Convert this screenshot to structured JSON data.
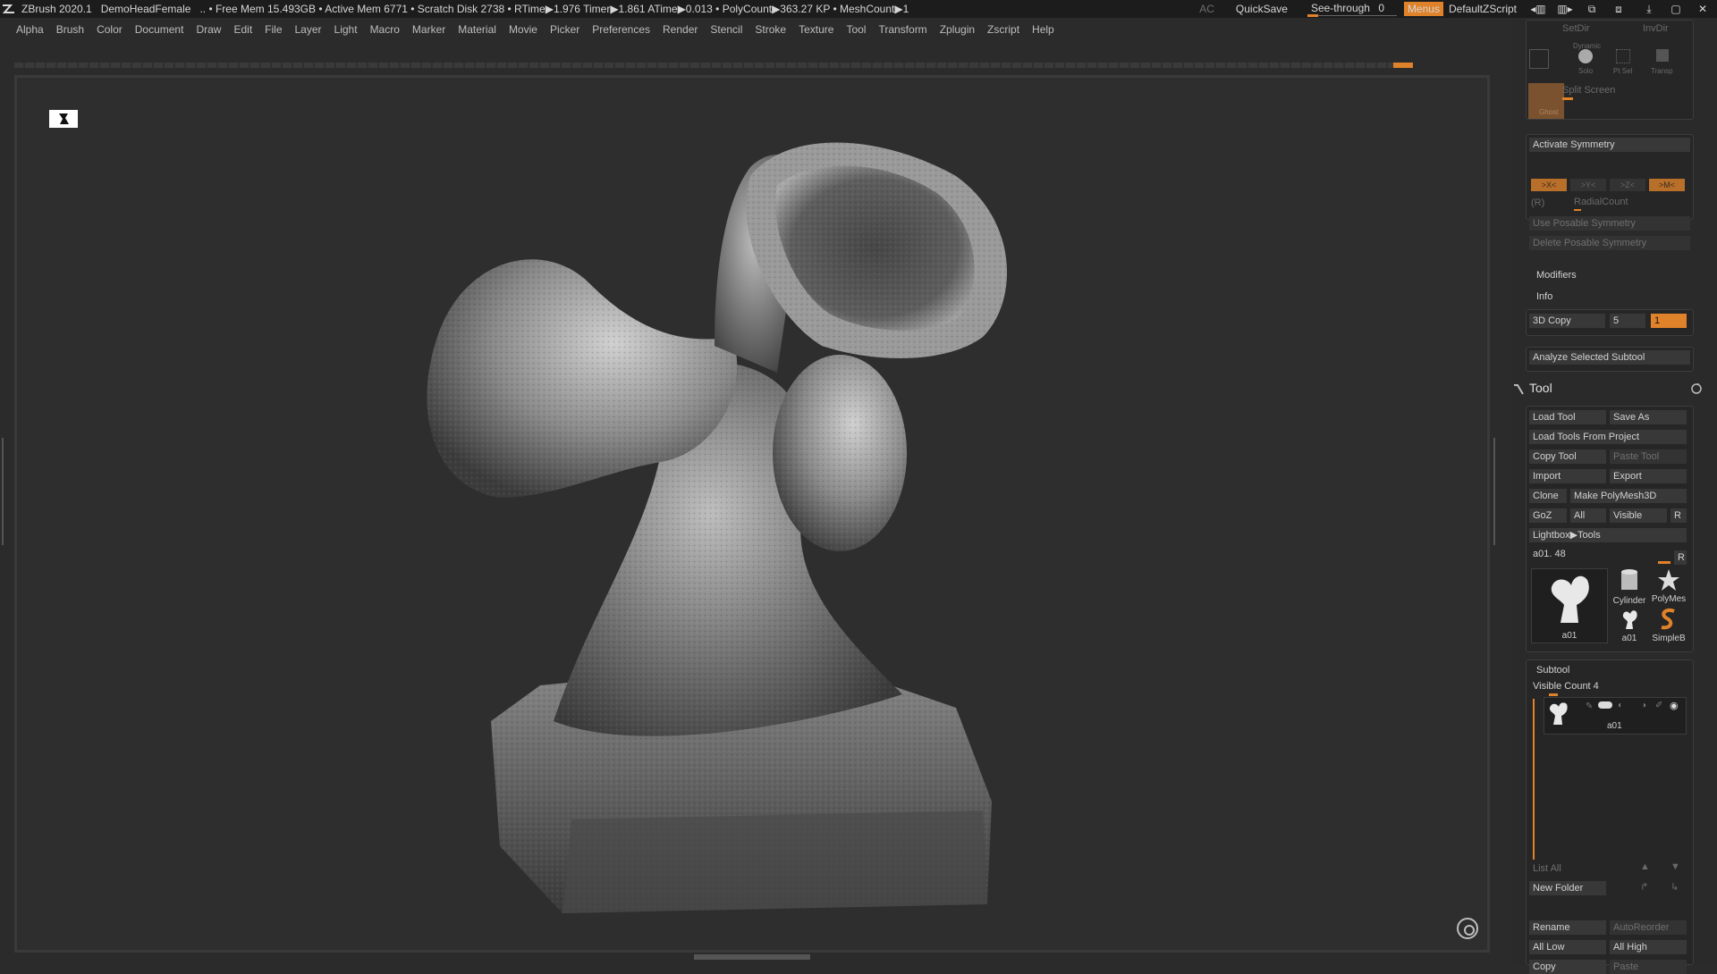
{
  "topbar": {
    "app": "ZBrush 2020.1",
    "project": "DemoHeadFemale",
    "info": "..  • Free Mem 15.493GB • Active Mem 6771 • Scratch Disk 2738 •  RTime▶1.976 Timer▶1.861 ATime▶0.013 • PolyCount▶363.27 KP  • MeshCount▶1",
    "ac": "AC",
    "quicksave": "QuickSave",
    "seethrough_label": "See-through",
    "seethrough_value": "0",
    "menus": "Menus",
    "script": "DefaultZScript"
  },
  "menubar": [
    "Alpha",
    "Brush",
    "Color",
    "Document",
    "Draw",
    "Edit",
    "File",
    "Layer",
    "Light",
    "Macro",
    "Marker",
    "Material",
    "Movie",
    "Picker",
    "Preferences",
    "Render",
    "Stencil",
    "Stroke",
    "Texture",
    "Tool",
    "Transform",
    "Zplugin",
    "Zscript",
    "Help"
  ],
  "panel": {
    "setdir": "SetDir",
    "invdir": "InvDir",
    "dynamic": "Dynamic",
    "solo": "Solo",
    "ptsel": "Pt Sel",
    "transp": "Transp",
    "ghost": "Ghost",
    "split_screen": "Split Screen",
    "activate_symmetry": "Activate Symmetry",
    "sym_x": ">X<",
    "sym_y": ">Y<",
    "sym_z": ">Z<",
    "sym_m": ">M<",
    "r_label": "(R)",
    "radial_count": "RadialCount",
    "use_posable": "Use Posable Symmetry",
    "delete_posable": "Delete Posable Symmetry",
    "modifiers": "Modifiers",
    "info": "Info",
    "copy3d": "3D Copy",
    "copy3d_val": "5",
    "copy3d_input": "1",
    "analyze": "Analyze Selected Subtool",
    "tool_title": "Tool",
    "load_tool": "Load Tool",
    "save_as": "Save As",
    "load_from_project": "Load Tools From Project",
    "copy_tool": "Copy Tool",
    "paste_tool": "Paste Tool",
    "import": "Import",
    "export": "Export",
    "clone": "Clone",
    "make_polymesh": "Make PolyMesh3D",
    "goz": "GoZ",
    "all": "All",
    "visible": "Visible",
    "r": "R",
    "lightbox_tools": "Lightbox▶Tools",
    "tool_slider": "a01. 48",
    "thumbs": {
      "main": "a01",
      "cylinder": "Cylinder",
      "polymesh": "PolyMes",
      "a01_small": "a01",
      "simpleb": "SimpleB"
    },
    "subtool": "Subtool",
    "visible_count": "Visible Count 4",
    "subtool_item": "a01",
    "list_all": "List All",
    "new_folder": "New Folder",
    "rename": "Rename",
    "auto_reorder": "AutoReorder",
    "all_low": "All Low",
    "all_high": "All High",
    "copy": "Copy",
    "paste": "Paste"
  },
  "colors": {
    "accent": "#e0822a",
    "background": "#2b2b2b",
    "topbar": "#1c1c1c"
  }
}
